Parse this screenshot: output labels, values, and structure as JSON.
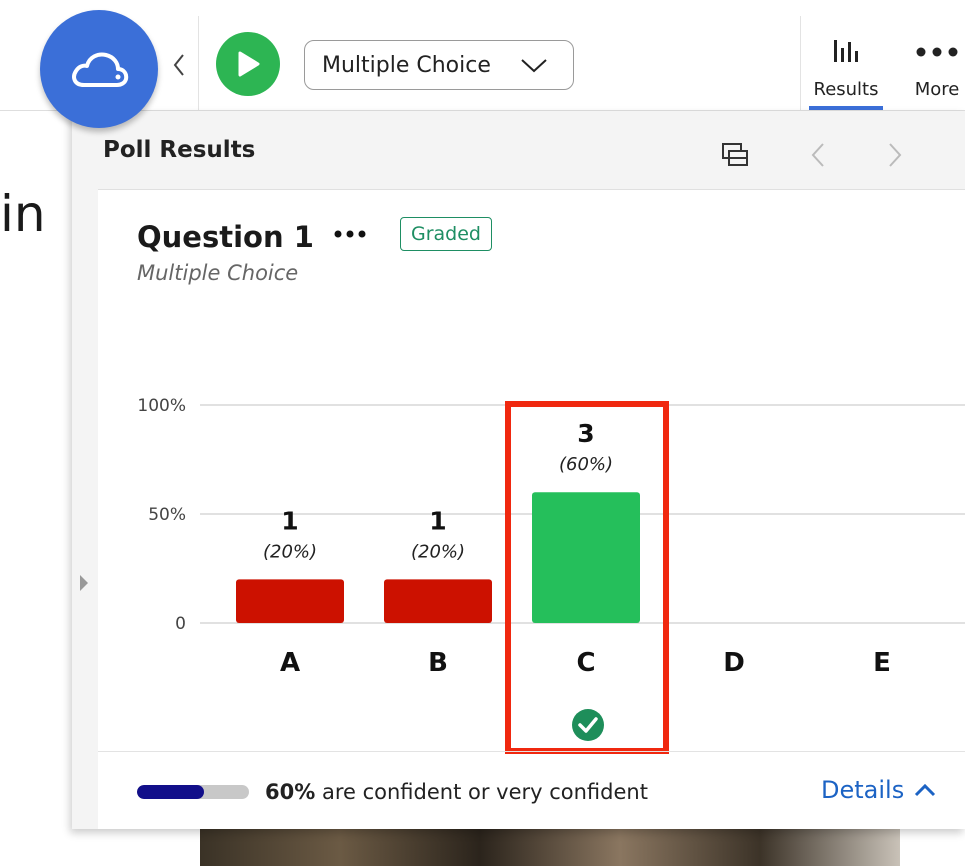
{
  "background": {
    "partial_text": "in"
  },
  "toolbar": {
    "question_type_select": "Multiple Choice",
    "tabs": [
      {
        "label": "Results",
        "icon": "bar-chart-icon",
        "active": true
      },
      {
        "label": "More",
        "icon": "more-dots-icon",
        "active": false
      }
    ]
  },
  "panel": {
    "title": "Poll Results"
  },
  "question": {
    "title": "Question 1",
    "badge": "Graded",
    "type": "Multiple Choice"
  },
  "chart_data": {
    "type": "bar",
    "categories": [
      "A",
      "B",
      "C",
      "D",
      "E"
    ],
    "counts": [
      1,
      1,
      3,
      null,
      null
    ],
    "count_labels": [
      "1",
      "1",
      "3",
      "",
      ""
    ],
    "percent_labels": [
      "(20%)",
      "(20%)",
      "(60%)",
      "",
      ""
    ],
    "values": [
      20,
      20,
      60,
      0,
      0
    ],
    "y_ticks": [
      "100%",
      "50%",
      "0"
    ],
    "ylim": [
      0,
      100
    ],
    "correct_category": "C",
    "colors": {
      "incorrect": "#cc1100",
      "correct": "#25bf5b"
    },
    "grid": true
  },
  "footer": {
    "confidence_percent": "60%",
    "confidence_text": "are confident or very confident",
    "confidence_fraction": 0.6,
    "details_label": "Details"
  },
  "colors": {
    "accent": "#3b6fd8",
    "play": "#2db553",
    "highlight": "#f0280f",
    "link": "#1c63c4"
  }
}
